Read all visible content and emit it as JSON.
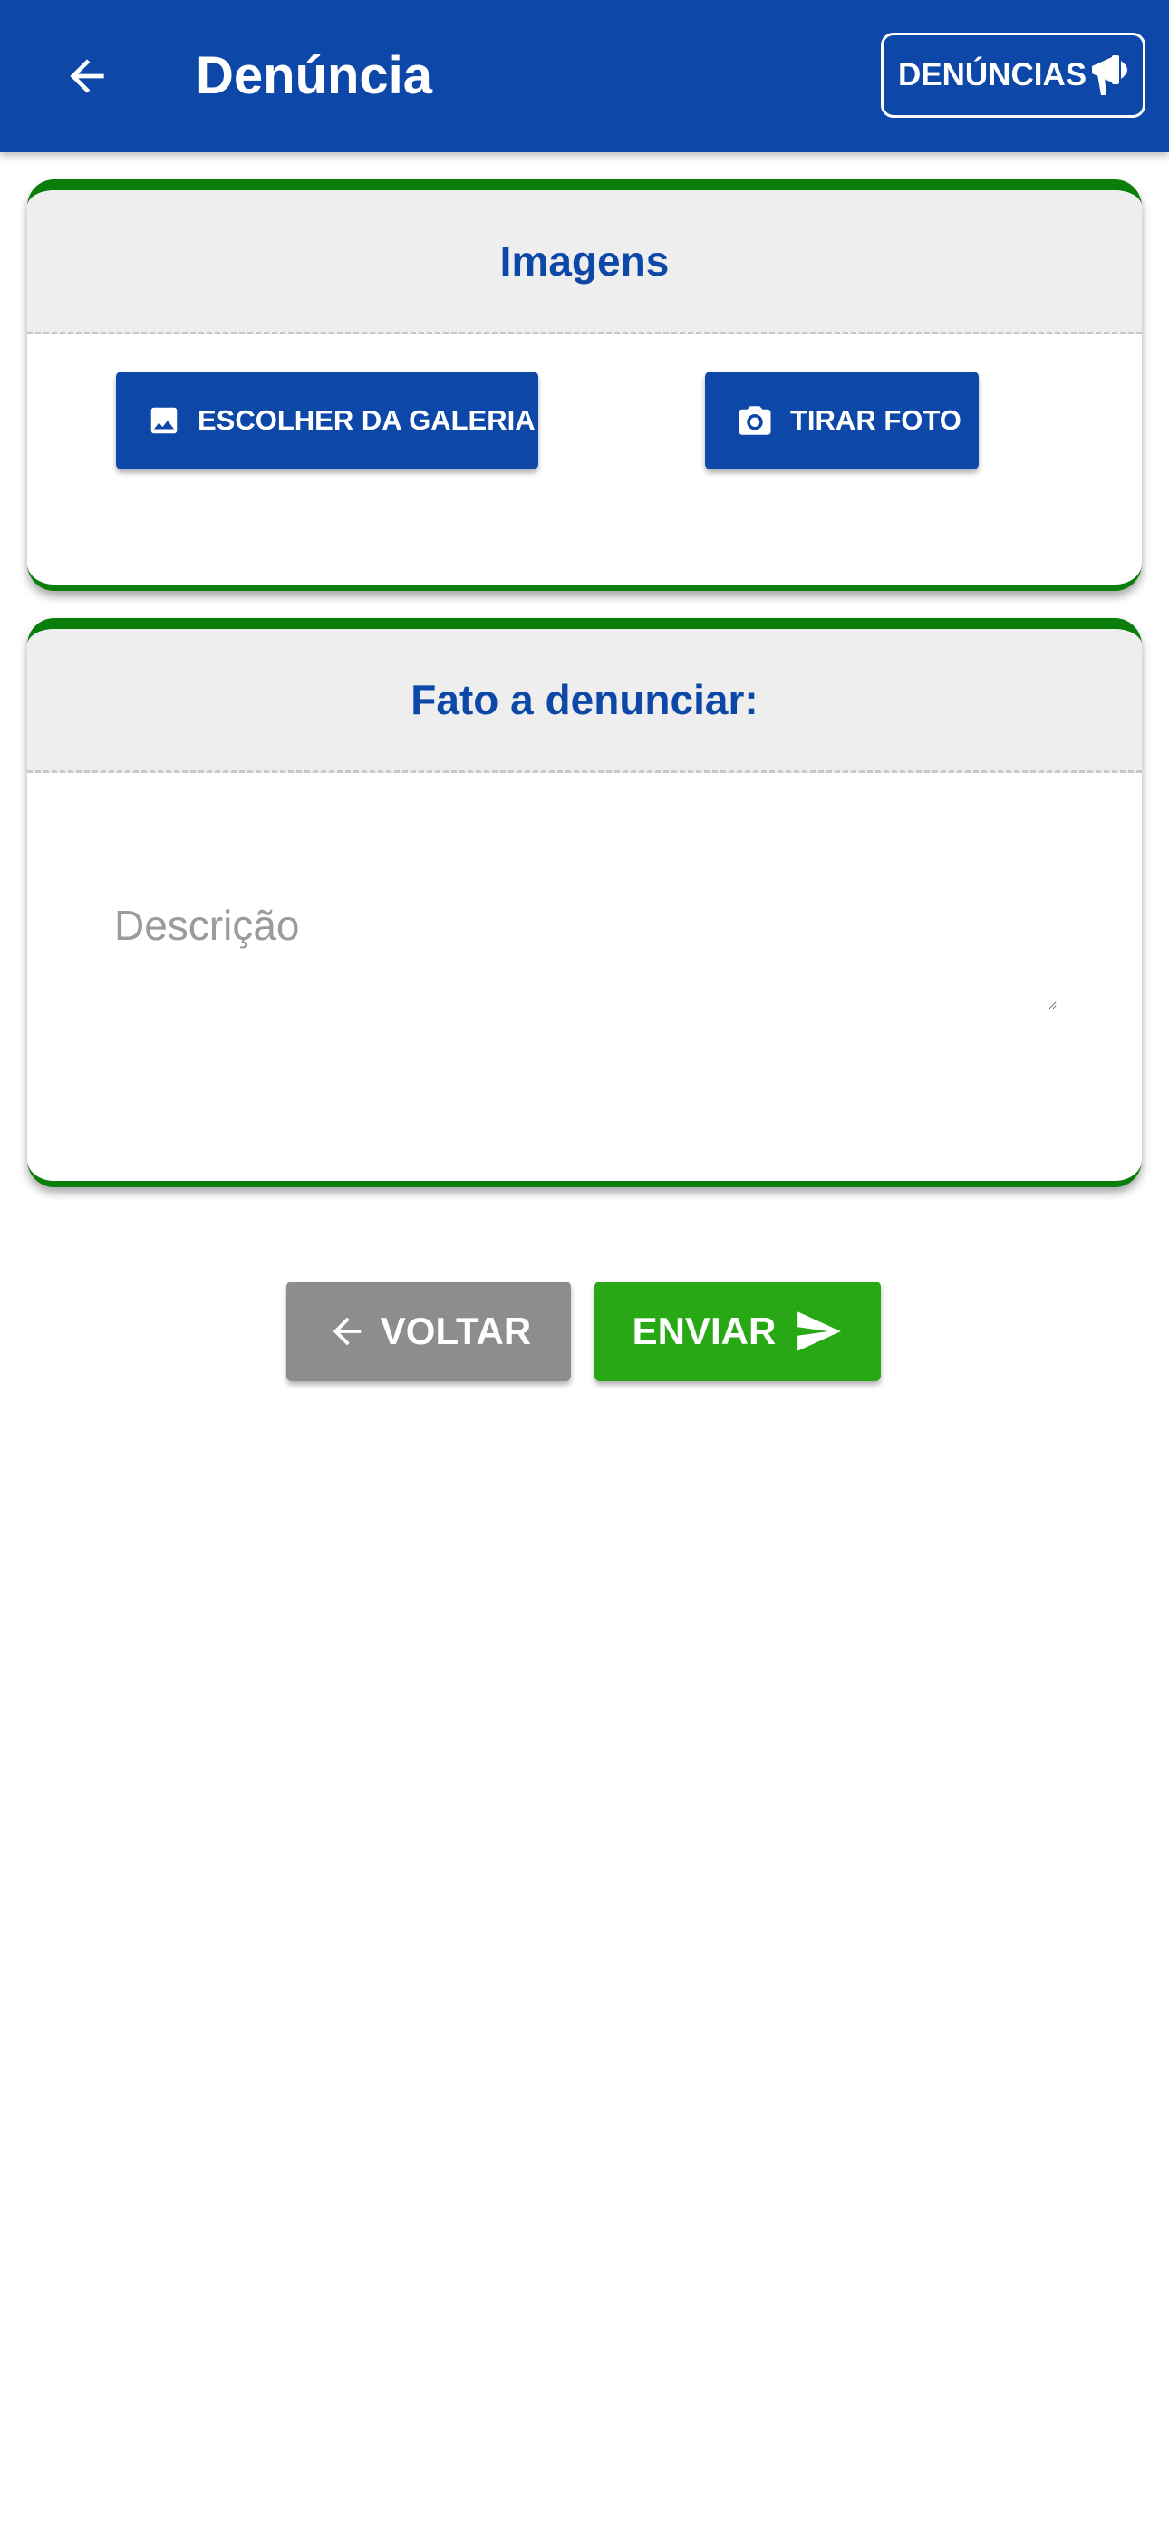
{
  "header": {
    "title": "Denúncia",
    "back_icon": "arrow-back-icon",
    "denuncias_label": "DENÚNCIAS",
    "denuncias_icon": "megaphone-icon",
    "background_color": "#0d47a7"
  },
  "images_card": {
    "title": "Imagens",
    "gallery_button_label": "ESCOLHER DA GALERIA",
    "gallery_icon": "image-icon",
    "camera_button_label": "TIRAR FOTO",
    "camera_icon": "camera-icon"
  },
  "fato_card": {
    "title": "Fato a denunciar:",
    "description_placeholder": "Descrição",
    "description_value": ""
  },
  "actions": {
    "voltar_label": "VOLTAR",
    "voltar_icon": "arrow-back-icon",
    "enviar_label": "ENVIAR",
    "enviar_icon": "send-icon"
  },
  "colors": {
    "primary": "#0d47a7",
    "card_border": "#0b7d0b",
    "send_button": "#28a814",
    "back_button": "#8d8d8d"
  }
}
